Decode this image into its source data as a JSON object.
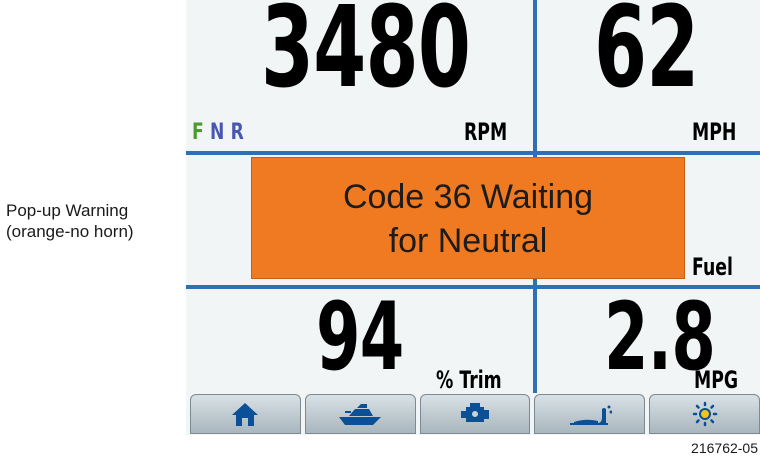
{
  "annotation": {
    "line1": "Pop-up Warning",
    "line2": "(orange-no horn)"
  },
  "gauges": {
    "rpm": {
      "value": "3480",
      "unit": "RPM"
    },
    "speed": {
      "value": "62",
      "unit": "MPH"
    },
    "fuel": {
      "unit": "Fuel"
    },
    "trim": {
      "value": "94",
      "unit": "% Trim"
    },
    "economy": {
      "value": "2.8",
      "unit": "MPG"
    }
  },
  "gear_indicator": {
    "forward": "F",
    "neutral": "N",
    "reverse": "R"
  },
  "popup": {
    "line1": "Code 36 Waiting",
    "line2": "for Neutral"
  },
  "tabs": [
    {
      "icon": "home-icon"
    },
    {
      "icon": "boat-icon"
    },
    {
      "icon": "engine-icon"
    },
    {
      "icon": "trim-icon"
    },
    {
      "icon": "brightness-icon"
    }
  ],
  "figure_id": "216762-05",
  "colors": {
    "divider": "#2e6fb5",
    "popup": "#f07a22",
    "gear_forward": "#4a9a2e",
    "gear_neutral": "#4a57b0",
    "gear_reverse": "#4a57b0",
    "icon": "#0b4f96",
    "arrow": "#e01b24"
  }
}
